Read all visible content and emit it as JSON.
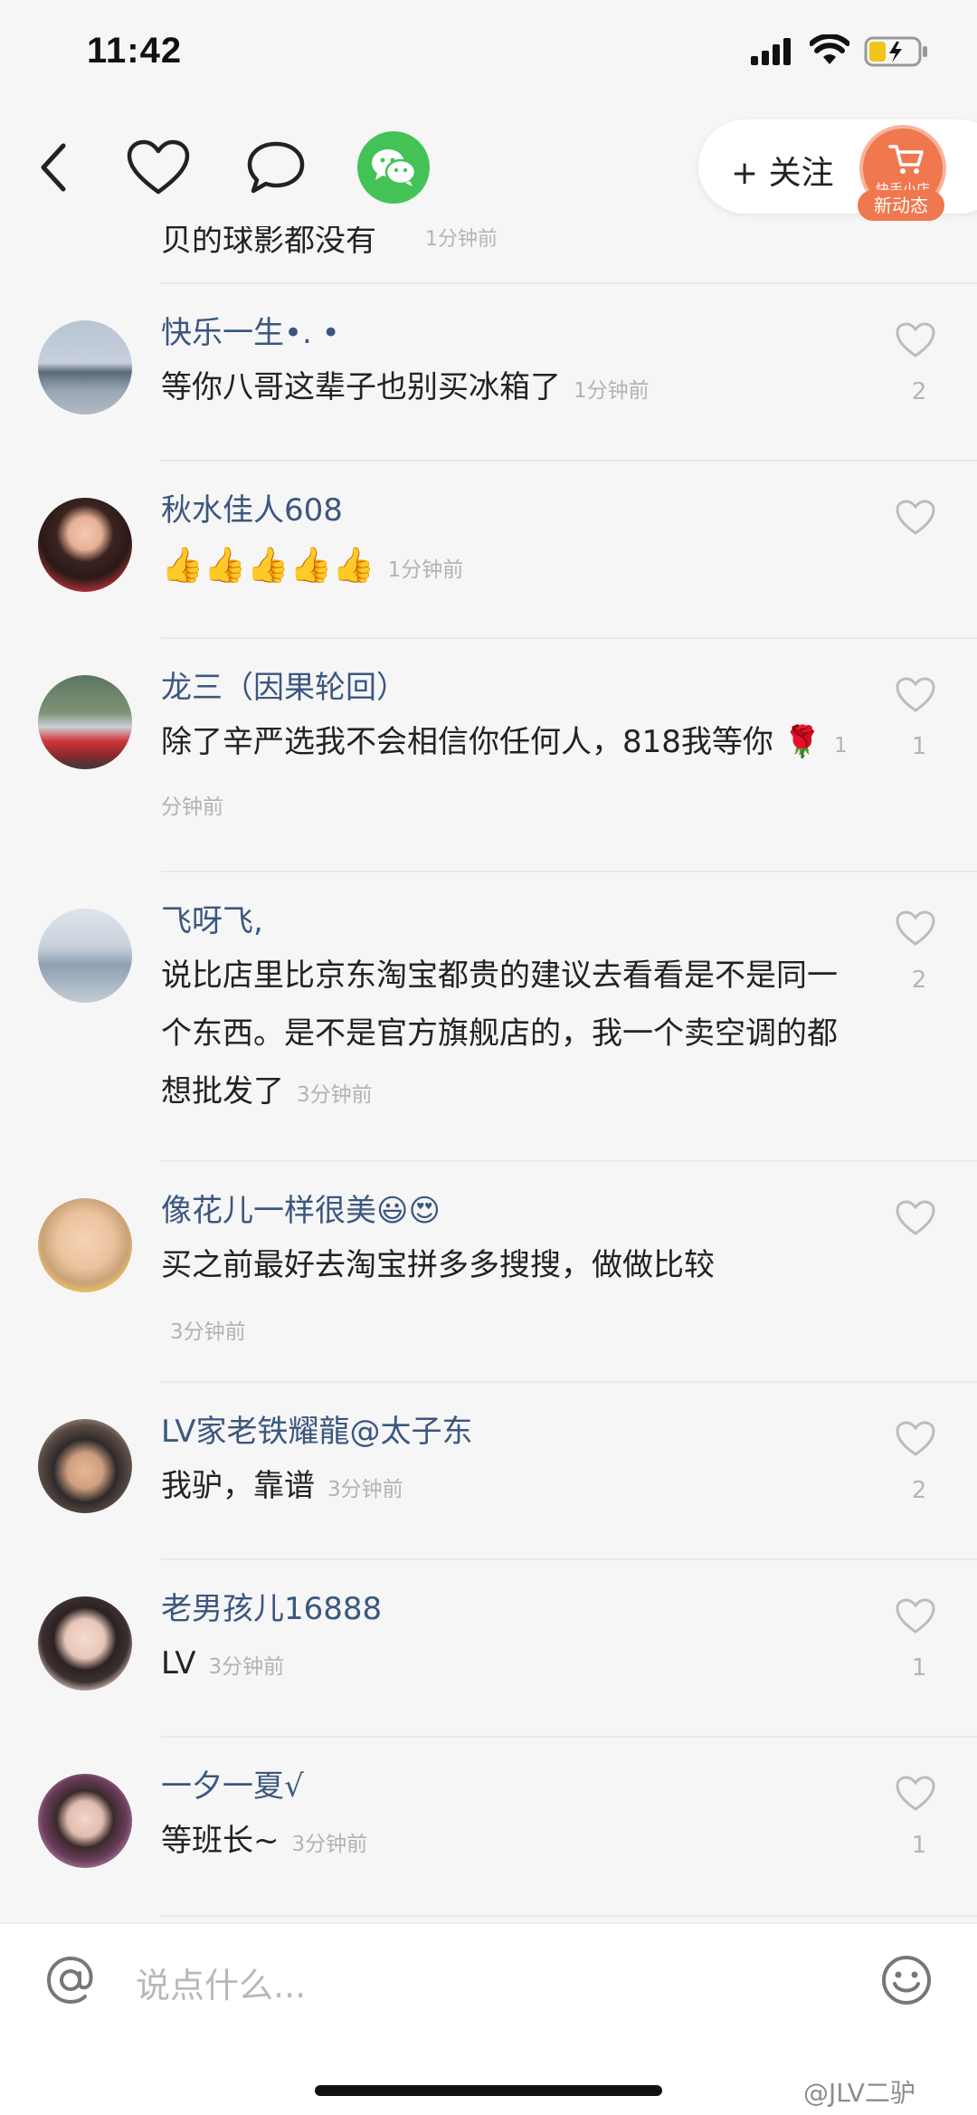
{
  "status_bar": {
    "time": "11:42"
  },
  "nav": {
    "follow_label": "+ 关注",
    "shop_label": "快手小店",
    "new_dynamic": "新动态"
  },
  "partial_comment": {
    "text": "贝的球影都没有",
    "time": "1分钟前"
  },
  "comments": [
    {
      "name": "快乐一生•. •",
      "text": "等你八哥这辈子也别买冰箱了",
      "time": "1分钟前",
      "likes": "2"
    },
    {
      "name": "秋水佳人608",
      "text": "👍👍👍👍👍",
      "time": "1分钟前",
      "likes": ""
    },
    {
      "name": "龙三（因果轮回）",
      "text": "除了辛严选我不会相信你任何人，818我等你 🌹",
      "time": "1分钟前",
      "likes": "1"
    },
    {
      "name": "飞呀飞,",
      "text": "说比店里比京东淘宝都贵的建议去看看是不是同一个东西。是不是官方旗舰店的，我一个卖空调的都想批发了",
      "time": "3分钟前",
      "likes": "2"
    },
    {
      "name": "像花儿一样很美😃😍",
      "text": "买之前最好去淘宝拼多多搜搜，做做比较",
      "time": "3分钟前",
      "likes": ""
    },
    {
      "name": "LV家老铁耀龍@太子东",
      "text": "我驴，靠谱",
      "time": "3分钟前",
      "likes": "2"
    },
    {
      "name": "老男孩儿16888",
      "text": "LV",
      "time": "3分钟前",
      "likes": "1"
    },
    {
      "name": "一夕一夏√",
      "text": "等班长~",
      "time": "3分钟前",
      "likes": "1"
    }
  ],
  "input": {
    "placeholder": "说点什么..."
  },
  "watermark": "@JLV二驴",
  "colors": {
    "name": "#3b5780",
    "wechat": "#43c356",
    "shop": "#f0784e"
  }
}
